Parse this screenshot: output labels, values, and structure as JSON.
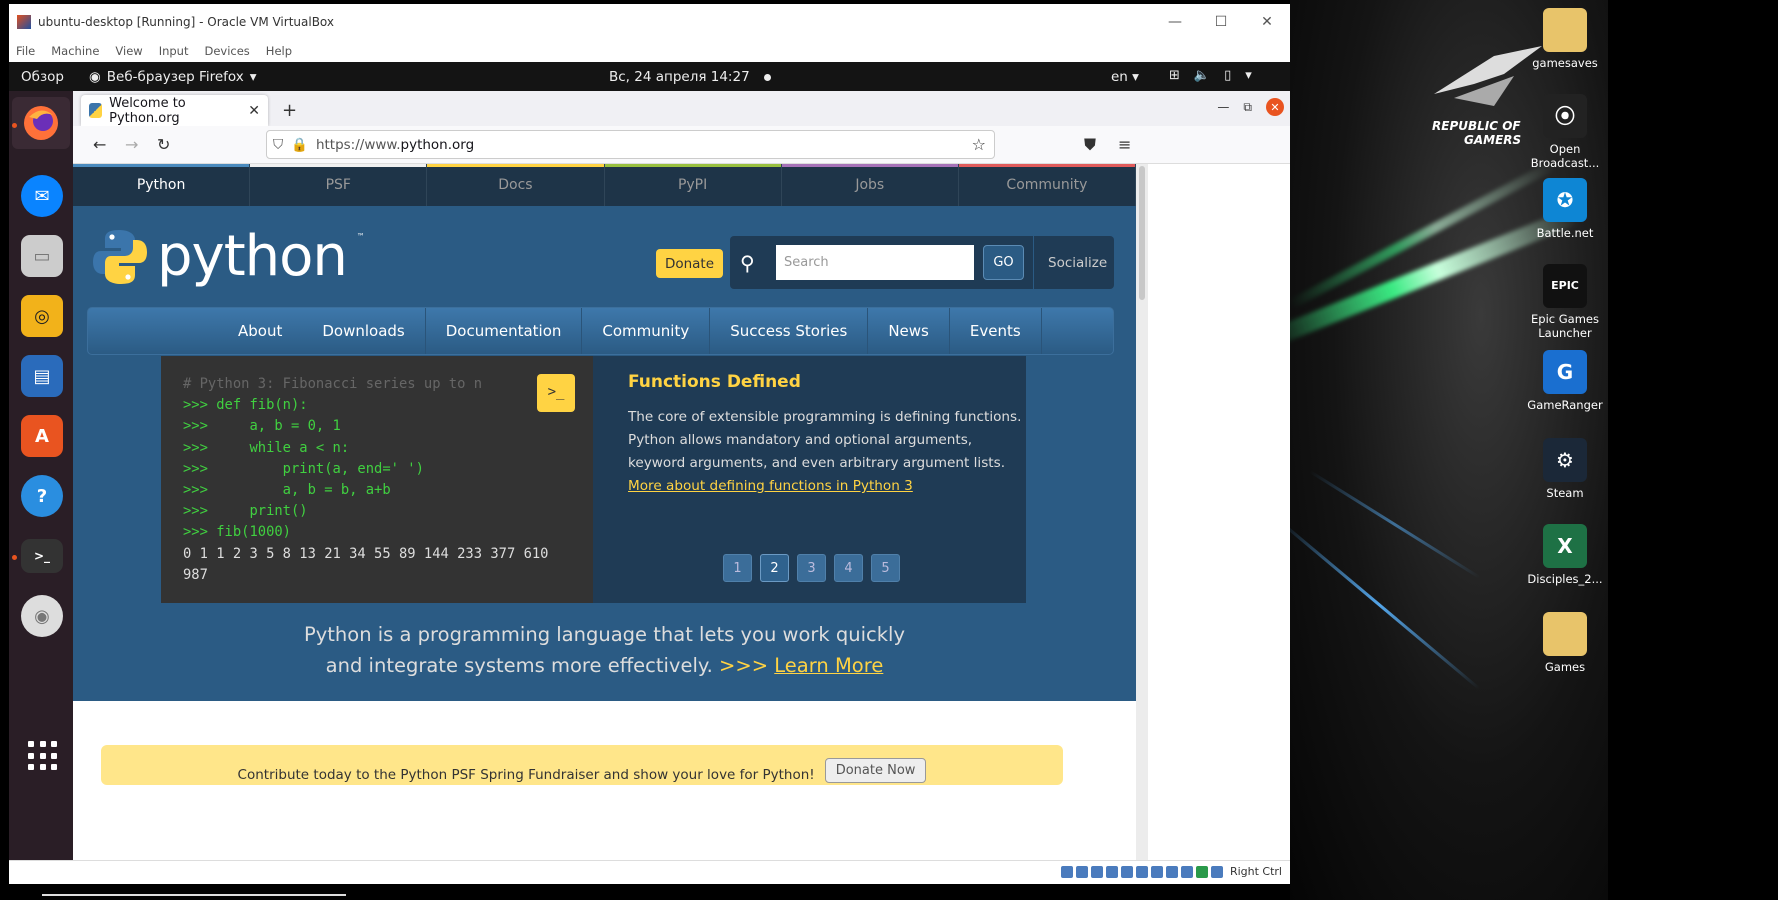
{
  "vbox": {
    "title": "ubuntu-desktop [Running] - Oracle VM VirtualBox",
    "menu": [
      "File",
      "Machine",
      "View",
      "Input",
      "Devices",
      "Help"
    ],
    "status_host_key": "Right Ctrl"
  },
  "ubuntu": {
    "activities": "Обзор",
    "app_menu": "Веб-браузер Firefox",
    "clock": "Вс, 24 апреля  14:27",
    "lang": "en"
  },
  "firefox": {
    "tab_title": "Welcome to Python.org",
    "url_prefix": "https://www.",
    "url_host": "python.org"
  },
  "site": {
    "meta_nav": [
      "Python",
      "PSF",
      "Docs",
      "PyPI",
      "Jobs",
      "Community"
    ],
    "meta_colors": [
      "#4b8bbe",
      "#f0f0f0",
      "#ffd343",
      "#98c03f",
      "#a672b8",
      "#e05b5b"
    ],
    "logo_word": "python",
    "logo_tm": "™",
    "donate": "Donate",
    "search_placeholder": "Search",
    "go": "GO",
    "socialize": "Socialize",
    "main_nav": [
      "About",
      "Downloads",
      "Documentation",
      "Community",
      "Success Stories",
      "News",
      "Events"
    ],
    "code_lines": [
      {
        "cls": "c",
        "text": "# Python 3: Fibonacci series up to n"
      },
      {
        "cls": "p",
        "text": ">>> def fib(n):"
      },
      {
        "cls": "p",
        "text": ">>>     a, b = 0, 1"
      },
      {
        "cls": "p",
        "text": ">>>     while a < n:"
      },
      {
        "cls": "p",
        "text": ">>>         print(a, end=' ')"
      },
      {
        "cls": "p",
        "text": ">>>         a, b = b, a+b"
      },
      {
        "cls": "p",
        "text": ">>>     print()"
      },
      {
        "cls": "p",
        "text": ">>> fib(1000)"
      },
      {
        "cls": "o",
        "text": "0 1 1 2 3 5 8 13 21 34 55 89 144 233 377 610"
      },
      {
        "cls": "o",
        "text": "987"
      }
    ],
    "shell_button": ">_",
    "feature_title": "Functions Defined",
    "feature_text": "The core of extensible programming is defining functions. Python allows mandatory and optional arguments, keyword arguments, and even arbitrary argument lists.",
    "feature_link": "More about defining functions in Python 3",
    "pager": [
      "1",
      "2",
      "3",
      "4",
      "5"
    ],
    "pager_active": "2",
    "intro_line1": "Python is a programming language that lets you work quickly",
    "intro_line2": "and integrate systems more effectively.",
    "intro_chevrons": ">>>",
    "learn_more": "Learn More",
    "banner_text": "Contribute today to the Python PSF Spring Fundraiser and show your love for Python!",
    "banner_button": "Donate Now"
  },
  "desktop": {
    "icons": [
      {
        "label": "gamesaves",
        "color": "#e8c46a",
        "glyph": ""
      },
      {
        "label": "Open Broadcast...",
        "color": "#222",
        "glyph": "⦿"
      },
      {
        "label": "Battle.net",
        "color": "#0e86d4",
        "glyph": "✪"
      },
      {
        "label": "Epic Games Launcher",
        "color": "#111",
        "glyph": "EPIC"
      },
      {
        "label": "GameRanger",
        "color": "#1a6fd0",
        "glyph": "G"
      },
      {
        "label": "Steam",
        "color": "#1b2838",
        "glyph": "⚙"
      },
      {
        "label": "Disciples_2...",
        "color": "#1e7145",
        "glyph": "X"
      },
      {
        "label": "Games",
        "color": "#e8c46a",
        "glyph": ""
      }
    ],
    "rog_line1": "REPUBLIC OF",
    "rog_line2": "GAMERS"
  }
}
